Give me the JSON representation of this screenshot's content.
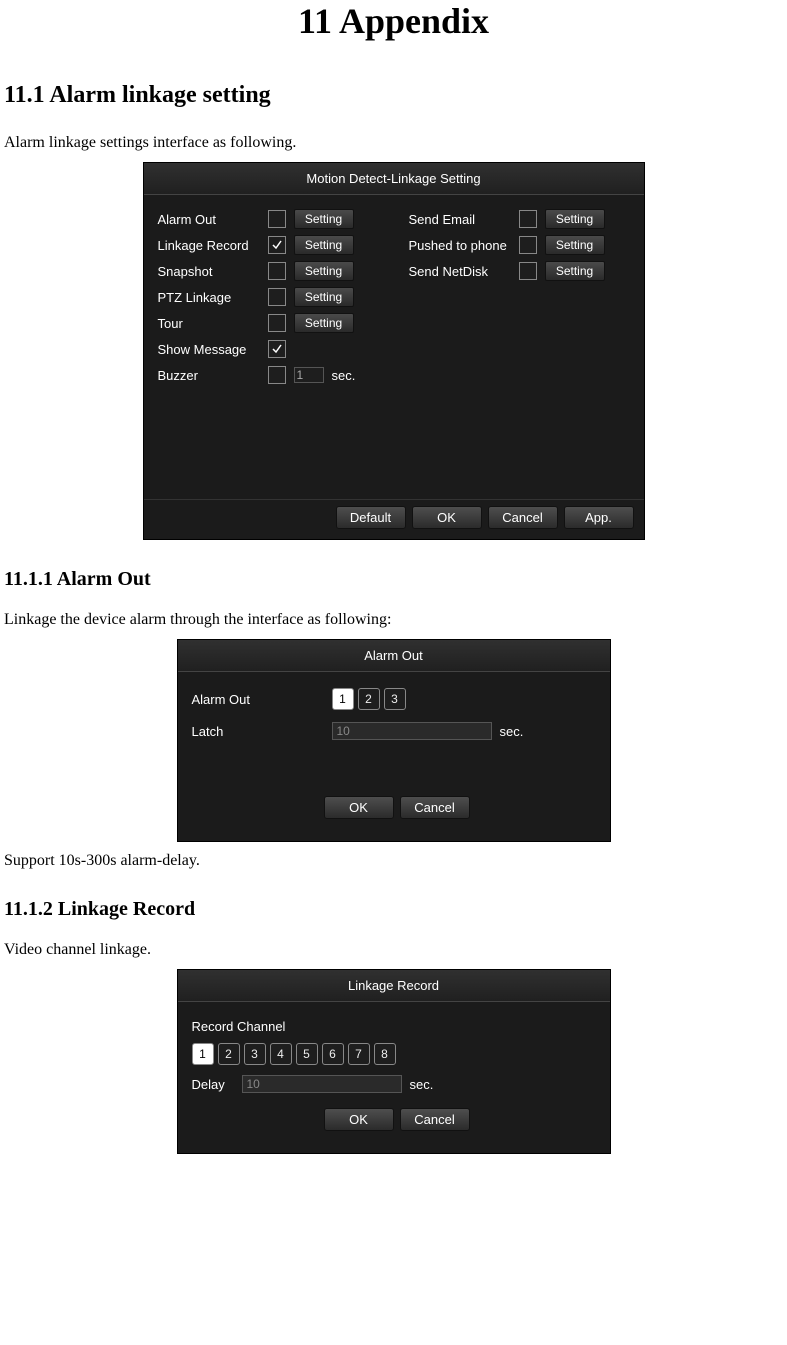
{
  "chapter_title": "11  Appendix",
  "section_11_1": "11.1 Alarm linkage setting",
  "section_11_1_desc": "Alarm linkage settings interface as following.",
  "dlg1": {
    "title": "Motion Detect-Linkage Setting",
    "left": {
      "alarm_out": "Alarm Out",
      "linkage_record": "Linkage Record",
      "snapshot": "Snapshot",
      "ptz_linkage": "PTZ Linkage",
      "tour": "Tour",
      "show_message": "Show Message",
      "buzzer": "Buzzer",
      "buzzer_val": "1",
      "buzzer_unit": "sec."
    },
    "right": {
      "send_email": "Send Email",
      "pushed_phone": "Pushed to phone",
      "send_netdisk": "Send NetDisk"
    },
    "setting_btn": "Setting",
    "footer": {
      "default": "Default",
      "ok": "OK",
      "cancel": "Cancel",
      "app": "App."
    }
  },
  "section_11_1_1": "11.1.1  Alarm Out",
  "section_11_1_1_desc": "Linkage the device alarm through the interface as following:",
  "dlg2": {
    "title": "Alarm Out",
    "alarm_out_label": "Alarm Out",
    "channels": [
      "1",
      "2",
      "3"
    ],
    "selected_channel": "1",
    "latch_label": "Latch",
    "latch_val": "10",
    "latch_unit": "sec.",
    "ok": "OK",
    "cancel": "Cancel"
  },
  "section_11_1_1_note": "Support 10s-300s alarm-delay.",
  "section_11_1_2": "11.1.2  Linkage Record",
  "section_11_1_2_desc": "Video channel linkage.",
  "dlg3": {
    "title": "Linkage Record",
    "record_channel_label": "Record Channel",
    "channels": [
      "1",
      "2",
      "3",
      "4",
      "5",
      "6",
      "7",
      "8"
    ],
    "selected_channel": "1",
    "delay_label": "Delay",
    "delay_val": "10",
    "delay_unit": "sec.",
    "ok": "OK",
    "cancel": "Cancel"
  }
}
